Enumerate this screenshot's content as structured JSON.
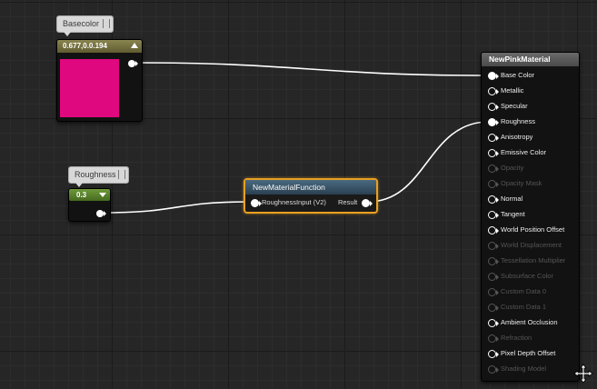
{
  "basecolor_node": {
    "comment": "Basecolor",
    "header_value": "0.677,0.0.194",
    "swatch_color": "#e0087e"
  },
  "roughness_node": {
    "comment": "Roughness",
    "value": "0.3"
  },
  "function_node": {
    "title": "NewMaterialFunction",
    "input_label": "RoughnessInput (V2)",
    "output_label": "Result",
    "highlight_color": "#e8a020"
  },
  "material_node": {
    "title": "NewPinkMaterial",
    "pins": [
      {
        "label": "Base Color",
        "state": "connected"
      },
      {
        "label": "Metallic",
        "state": "empty"
      },
      {
        "label": "Specular",
        "state": "empty"
      },
      {
        "label": "Roughness",
        "state": "connected"
      },
      {
        "label": "Anisotropy",
        "state": "empty"
      },
      {
        "label": "Emissive Color",
        "state": "empty"
      },
      {
        "label": "Opacity",
        "state": "disabled"
      },
      {
        "label": "Opacity Mask",
        "state": "disabled"
      },
      {
        "label": "Normal",
        "state": "empty"
      },
      {
        "label": "Tangent",
        "state": "empty"
      },
      {
        "label": "World Position Offset",
        "state": "empty"
      },
      {
        "label": "World Displacement",
        "state": "disabled"
      },
      {
        "label": "Tessellation Multiplier",
        "state": "disabled"
      },
      {
        "label": "Subsurface Color",
        "state": "disabled"
      },
      {
        "label": "Custom Data 0",
        "state": "disabled"
      },
      {
        "label": "Custom Data 1",
        "state": "disabled"
      },
      {
        "label": "Ambient Occlusion",
        "state": "empty"
      },
      {
        "label": "Refraction",
        "state": "disabled"
      },
      {
        "label": "Pixel Depth Offset",
        "state": "empty"
      },
      {
        "label": "Shading Model",
        "state": "disabled"
      }
    ]
  },
  "icons": {
    "move": "move-icon"
  }
}
